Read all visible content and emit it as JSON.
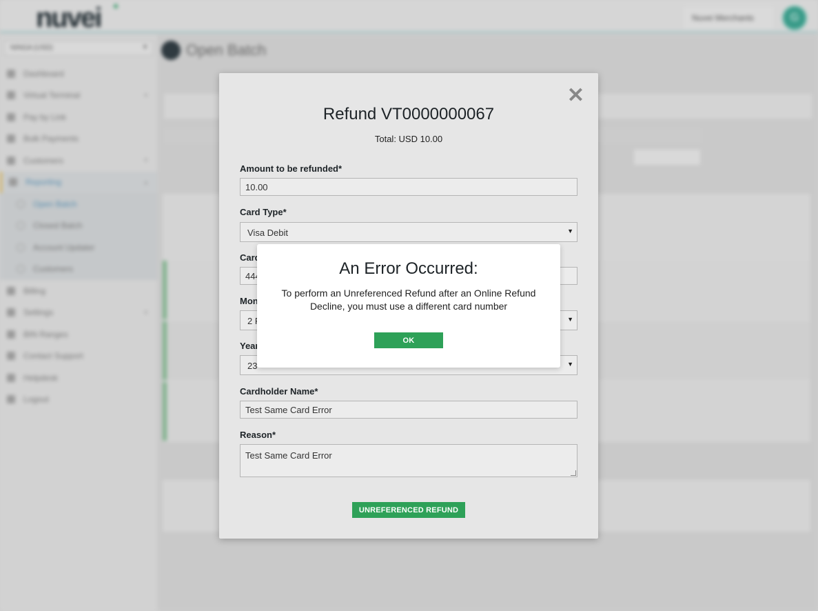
{
  "app": {
    "logo": "nuvei",
    "merchant": "Nuvei Merchants",
    "avatar_initial": "G"
  },
  "sidebar": {
    "selector": "NINGA (USD)",
    "items": [
      {
        "label": "Dashboard"
      },
      {
        "label": "Virtual Terminal"
      },
      {
        "label": "Pay by Link"
      },
      {
        "label": "Bulk Payments"
      },
      {
        "label": "Customers"
      },
      {
        "label": "Reporting"
      },
      {
        "label": "Open Batch"
      },
      {
        "label": "Closed Batch"
      },
      {
        "label": "Account Updater"
      },
      {
        "label": "Customers"
      },
      {
        "label": "Billing"
      },
      {
        "label": "Settings"
      },
      {
        "label": "BIN Ranges"
      },
      {
        "label": "Contact Support"
      },
      {
        "label": "Helpdesk"
      },
      {
        "label": "Logout"
      }
    ]
  },
  "page": {
    "title": "Open Batch"
  },
  "refund_modal": {
    "title": "Refund VT0000000067",
    "total": "Total: USD 10.00",
    "amount_label": "Amount to be refunded*",
    "amount_value": "10.00",
    "card_type_label": "Card Type*",
    "card_type_value": "Visa Debit",
    "card_number_label": "Card",
    "card_number_value": "444",
    "month_label": "Mon",
    "month_value": "2 F",
    "year_label": "Year",
    "year_value": "23",
    "cardholder_label": "Cardholder Name*",
    "cardholder_value": "Test Same Card Error",
    "reason_label": "Reason*",
    "reason_value": "Test Same Card Error",
    "submit_label": "UNREFERENCED REFUND"
  },
  "error_dialog": {
    "title": "An Error Occurred:",
    "message": "To perform an Unreferenced Refund after an Online Refund Decline, you must use a different card number",
    "ok_label": "OK"
  },
  "colors": {
    "accent_green": "#2ea158",
    "overlay_gray": "#cfcfcf"
  }
}
